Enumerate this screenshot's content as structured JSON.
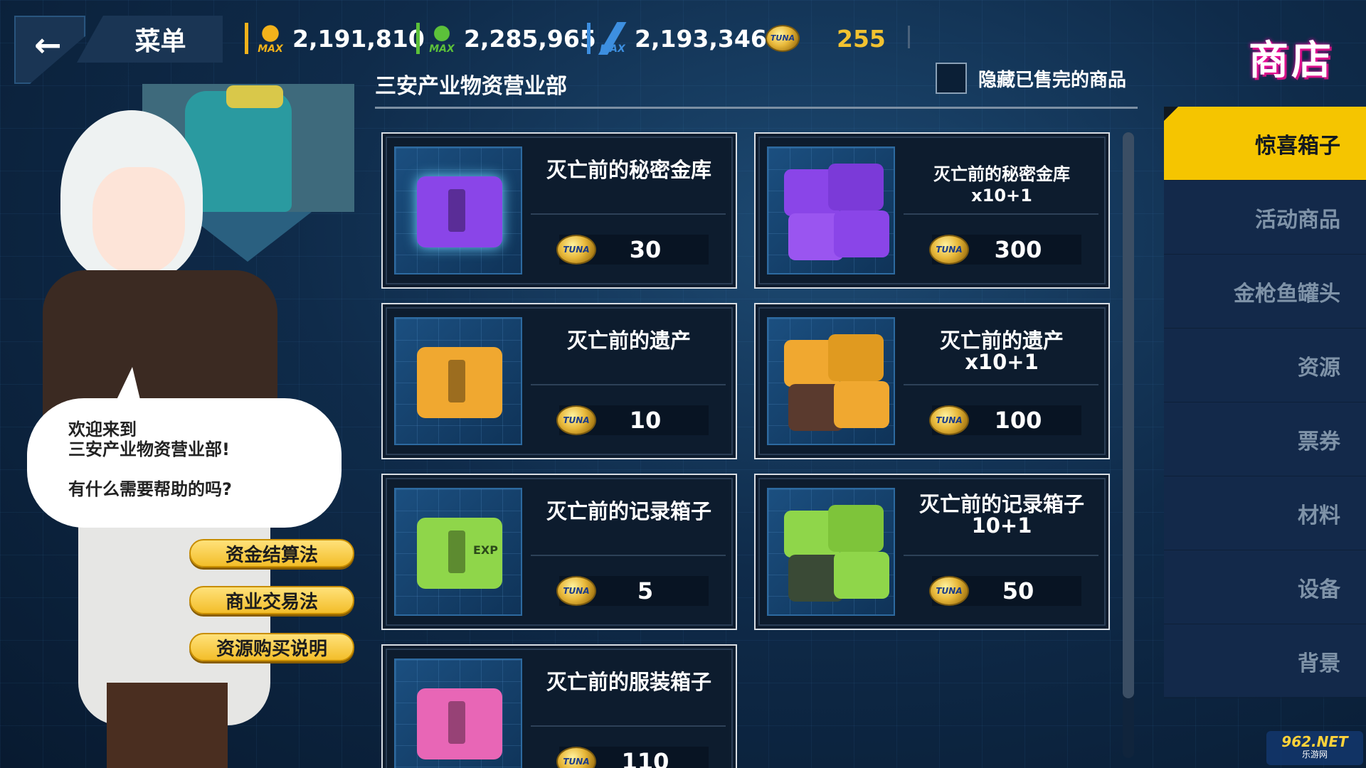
{
  "header": {
    "back_icon": "←",
    "menu_label": "菜单",
    "resources": [
      {
        "icon": "gear-max-icon",
        "cap": "MAX",
        "value": "2,191,810",
        "color": "#f2b21b"
      },
      {
        "icon": "energy-max-icon",
        "cap": "MAX",
        "value": "2,285,965",
        "color": "#5cc13a"
      },
      {
        "icon": "lightning-max-icon",
        "cap": "MAX",
        "value": "2,193,346",
        "color": "#3d8fe0"
      }
    ],
    "coin_icon": "TUNA",
    "coin_value": "255",
    "shop_title": "商店"
  },
  "department": {
    "name": "三安产业物资营业部",
    "hide_sold_label": "隐藏已售完的商品",
    "hide_sold_checked": false
  },
  "nav": {
    "items": [
      {
        "label": "惊喜箱子",
        "active": true
      },
      {
        "label": "活动商品",
        "active": false
      },
      {
        "label": "金枪鱼罐头",
        "active": false
      },
      {
        "label": "资源",
        "active": false
      },
      {
        "label": "票券",
        "active": false
      },
      {
        "label": "材料",
        "active": false
      },
      {
        "label": "设备",
        "active": false
      },
      {
        "label": "背景",
        "active": false
      }
    ]
  },
  "products": [
    {
      "title": "灭亡前的秘密金库",
      "price": "30",
      "box_color": "#8a45e8",
      "icon": "purple-vault-box-icon"
    },
    {
      "title": "灭亡前的秘密金库x10+1",
      "price": "300",
      "box_color": "#8a45e8",
      "icon": "purple-vault-stack-icon"
    },
    {
      "title": "灭亡前的遗产",
      "price": "10",
      "box_color": "#f0a830",
      "icon": "orange-legacy-box-icon"
    },
    {
      "title": "灭亡前的遗产x10+1",
      "price": "100",
      "box_color": "#f0a830",
      "icon": "orange-legacy-stack-icon"
    },
    {
      "title": "灭亡前的记录箱子",
      "price": "5",
      "box_color": "#8fd64a",
      "icon": "green-record-box-icon",
      "box_text": "EXP"
    },
    {
      "title": "灭亡前的记录箱子\n10+1",
      "price": "50",
      "box_color": "#8fd64a",
      "icon": "green-record-stack-icon"
    },
    {
      "title": "灭亡前的服装箱子",
      "price": "110",
      "box_color": "#e866b6",
      "icon": "pink-costume-box-icon"
    }
  ],
  "character": {
    "speech_line1": "欢迎来到",
    "speech_line2": "三安产业物资营业部!",
    "speech_line3": "有什么需要帮助的吗?",
    "buttons": [
      "资金结算法",
      "商业交易法",
      "资源购买说明"
    ]
  },
  "watermark": {
    "brand": "962.NET",
    "sub": "乐游网"
  }
}
